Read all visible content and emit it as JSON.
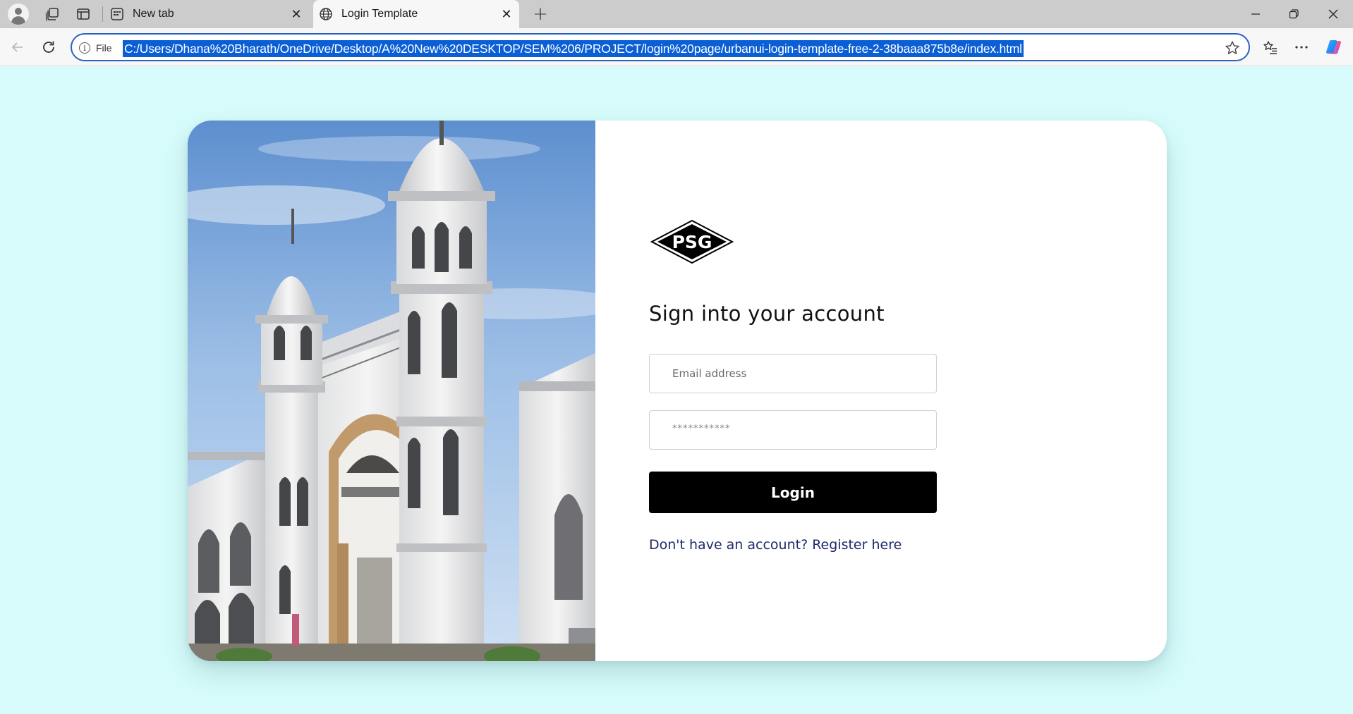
{
  "browser": {
    "tabs": [
      {
        "title": "New tab",
        "active": false,
        "icon": "newtab-icon"
      },
      {
        "title": "Login Template",
        "active": true,
        "icon": "globe-icon"
      }
    ],
    "site_info_label": "File",
    "url": "C:/Users/Dhana%20Bharath/OneDrive/Desktop/A%20New%20DESKTOP/SEM%206/PROJECT/login%20page/urbanui-login-template-free-2-38baaa875b8e/index.html"
  },
  "page": {
    "logo_text": "PSG",
    "heading": "Sign into your account",
    "email_placeholder": "Email address",
    "password_placeholder": "***********",
    "login_label": "Login",
    "register_text": "Don't have an account? Register here",
    "colors": {
      "background": "#d8fcfc",
      "button": "#000000",
      "link": "#1d2b6b"
    }
  }
}
